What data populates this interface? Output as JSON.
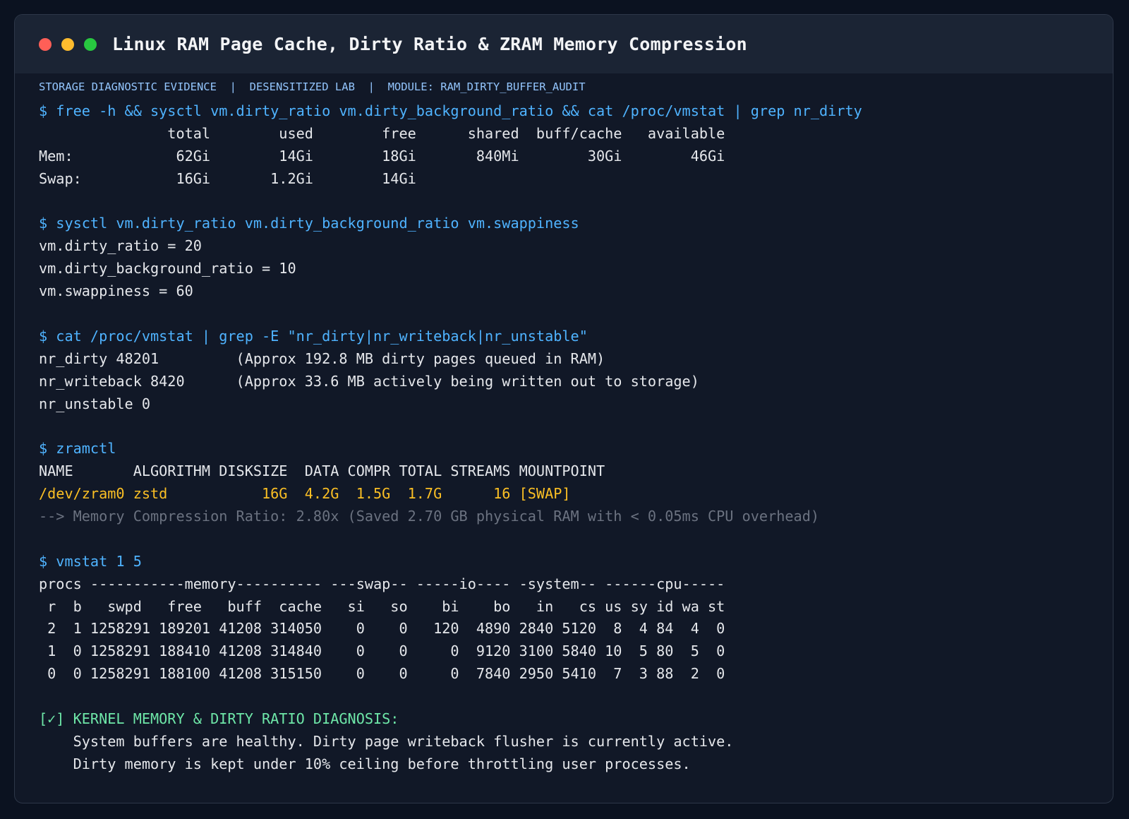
{
  "window": {
    "title": "Linux RAM Page Cache, Dirty Ratio & ZRAM Memory Compression"
  },
  "meta": {
    "text": "STORAGE DIAGNOSTIC EVIDENCE  |  DESENSITIZED LAB  |  MODULE: RAM_DIRTY_BUFFER_AUDIT"
  },
  "terminal": {
    "lines": [
      {
        "kind": "cmd",
        "text": "$ free -h && sysctl vm.dirty_ratio vm.dirty_background_ratio && cat /proc/vmstat | grep nr_dirty"
      },
      {
        "kind": "out",
        "text": "               total        used        free      shared  buff/cache   available"
      },
      {
        "kind": "out",
        "text": "Mem:            62Gi        14Gi        18Gi       840Mi        30Gi        46Gi"
      },
      {
        "kind": "out",
        "text": "Swap:           16Gi       1.2Gi        14Gi"
      },
      {
        "kind": "blank",
        "text": ""
      },
      {
        "kind": "cmd",
        "text": "$ sysctl vm.dirty_ratio vm.dirty_background_ratio vm.swappiness"
      },
      {
        "kind": "out",
        "text": "vm.dirty_ratio = 20"
      },
      {
        "kind": "out",
        "text": "vm.dirty_background_ratio = 10"
      },
      {
        "kind": "out",
        "text": "vm.swappiness = 60"
      },
      {
        "kind": "blank",
        "text": ""
      },
      {
        "kind": "cmd",
        "text": "$ cat /proc/vmstat | grep -E \"nr_dirty|nr_writeback|nr_unstable\""
      },
      {
        "kind": "out",
        "text": "nr_dirty 48201         (Approx 192.8 MB dirty pages queued in RAM)"
      },
      {
        "kind": "out",
        "text": "nr_writeback 8420      (Approx 33.6 MB actively being written out to storage)"
      },
      {
        "kind": "out",
        "text": "nr_unstable 0"
      },
      {
        "kind": "blank",
        "text": ""
      },
      {
        "kind": "cmd",
        "text": "$ zramctl"
      },
      {
        "kind": "out",
        "text": "NAME       ALGORITHM DISKSIZE  DATA COMPR TOTAL STREAMS MOUNTPOINT"
      },
      {
        "kind": "hl",
        "text": "/dev/zram0 zstd           16G  4.2G  1.5G  1.7G      16 [SWAP]"
      },
      {
        "kind": "note",
        "text": "--> Memory Compression Ratio: 2.80x (Saved 2.70 GB physical RAM with < 0.05ms CPU overhead)"
      },
      {
        "kind": "blank",
        "text": ""
      },
      {
        "kind": "cmd",
        "text": "$ vmstat 1 5"
      },
      {
        "kind": "out",
        "text": "procs -----------memory---------- ---swap-- -----io---- -system-- ------cpu-----"
      },
      {
        "kind": "out",
        "text": " r  b   swpd   free   buff  cache   si   so    bi    bo   in   cs us sy id wa st"
      },
      {
        "kind": "out",
        "text": " 2  1 1258291 189201 41208 314050    0    0   120  4890 2840 5120  8  4 84  4  0"
      },
      {
        "kind": "out",
        "text": " 1  0 1258291 188410 41208 314840    0    0     0  9120 3100 5840 10  5 80  5  0"
      },
      {
        "kind": "out",
        "text": " 0  0 1258291 188100 41208 315150    0    0     0  7840 2950 5410  7  3 88  2  0"
      },
      {
        "kind": "blank",
        "text": ""
      },
      {
        "kind": "ok",
        "text": "[✓] KERNEL MEMORY & DIRTY RATIO DIAGNOSIS:"
      },
      {
        "kind": "out",
        "text": "    System buffers are healthy. Dirty page writeback flusher is currently active."
      },
      {
        "kind": "out",
        "text": "    Dirty memory is kept under 10% ceiling before throttling user processes."
      }
    ]
  }
}
